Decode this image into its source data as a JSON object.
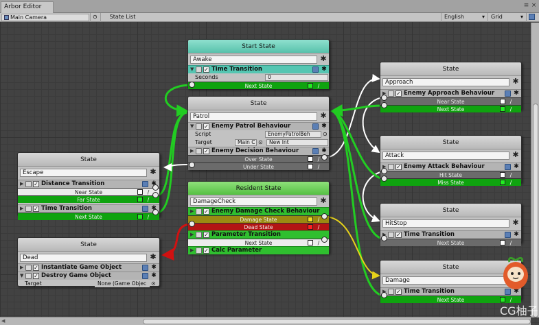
{
  "window": {
    "tab_title": "Arbor Editor"
  },
  "toolbar": {
    "target_object": "Main Camera",
    "state_list_label": "State List",
    "language": "English",
    "grid_label": "Grid"
  },
  "colors": {
    "start_header": "#58c2ab",
    "resident_header": "#55c043",
    "green_wire": "#22cc22",
    "red_wire": "#d11111",
    "yellow_wire": "#e6d21a",
    "white_wire": "#ffffff"
  },
  "nodes": {
    "start": {
      "header": "Start State",
      "name": "Awake",
      "component": "Time Transition",
      "prop_label": "Seconds",
      "prop_value": "0",
      "link": "Next State"
    },
    "patrol": {
      "header": "State",
      "name": "Patrol",
      "comp1": "Enemy Patrol Behaviour",
      "script_label": "Script",
      "script_value": "EnemyPatrolBeh",
      "target_label": "Target",
      "target_value": "Main C",
      "target_option": "New Int",
      "comp2": "Enemy Decision Behaviour",
      "link1": "Over State",
      "link2": "Under State"
    },
    "escape": {
      "header": "State",
      "name": "Escape",
      "comp1": "Distance Transition",
      "link1": "Near State",
      "link2": "Far State",
      "comp2": "Time Transition",
      "link3": "Next State"
    },
    "dead": {
      "header": "State",
      "name": "Dead",
      "comp1": "Instantiate Game Object",
      "comp2": "Destroy Game Object",
      "target_label": "Target",
      "target_value": "None (Game Objec"
    },
    "resident": {
      "header": "Resident State",
      "name": "DamageCheck",
      "comp1": "Enemy Damage Check Behaviour",
      "link1": "Damage State",
      "link2": "Dead State",
      "comp2": "Parameter Transition",
      "link3": "Next State",
      "comp3": "Calc Parameter"
    },
    "approach": {
      "header": "State",
      "name": "Approach",
      "comp1": "Enemy Approach Behaviour",
      "link1": "Near State",
      "link2": "Next State"
    },
    "attack": {
      "header": "State",
      "name": "Attack",
      "comp1": "Enemy Attack Behaviour",
      "link1": "Hit State",
      "link2": "Miss State"
    },
    "hitstop": {
      "header": "State",
      "name": "HitStop",
      "comp1": "Time Transition",
      "link1": "Next State"
    },
    "damage": {
      "header": "State",
      "name": "Damage",
      "comp1": "Time Transition",
      "link1": "Next State"
    }
  },
  "watermark": {
    "text": "CG柚子"
  }
}
